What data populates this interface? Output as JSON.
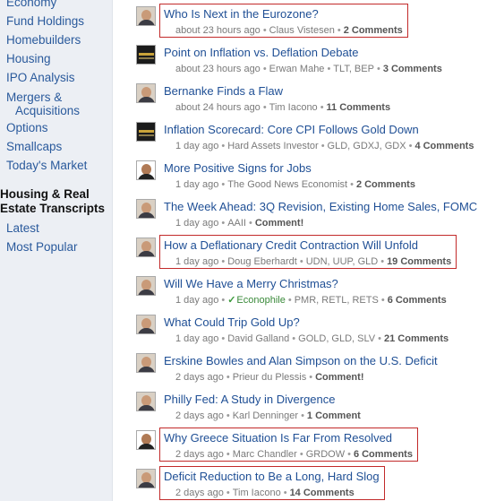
{
  "sidebar": {
    "links_top": [
      {
        "name": "sidebar-item-economy",
        "label": "Economy"
      },
      {
        "name": "sidebar-item-fund-holdings",
        "label": "Fund Holdings"
      },
      {
        "name": "sidebar-item-homebuilders",
        "label": "Homebuilders"
      },
      {
        "name": "sidebar-item-housing",
        "label": "Housing"
      },
      {
        "name": "sidebar-item-ipo-analysis",
        "label": "IPO Analysis"
      },
      {
        "name": "sidebar-item-mergers",
        "label": "Mergers &",
        "label2": "Acquisitions"
      },
      {
        "name": "sidebar-item-options",
        "label": "Options"
      },
      {
        "name": "sidebar-item-smallcaps",
        "label": "Smallcaps"
      },
      {
        "name": "sidebar-item-todays-market",
        "label": "Today's Market"
      }
    ],
    "heading_line1": "Housing & Real",
    "heading_line2": "Estate Transcripts",
    "links_bottom": [
      {
        "name": "sidebar-item-latest",
        "label": "Latest"
      },
      {
        "name": "sidebar-item-most-popular",
        "label": "Most Popular"
      }
    ]
  },
  "articles": [
    {
      "title": "Who Is Next in the Eurozone?",
      "time": "about 23 hours ago",
      "author": "Claus Vistesen",
      "tickers": "",
      "comments": "2 Comments",
      "avatar": "person",
      "highlighted": true
    },
    {
      "title": "Point on Inflation vs. Deflation Debate",
      "time": "about 23 hours ago",
      "author": "Erwan Mahe",
      "tickers": "TLT, BEP",
      "comments": "3 Comments",
      "avatar": "logo",
      "highlighted": false
    },
    {
      "title": "Bernanke Finds a Flaw",
      "time": "about 24 hours ago",
      "author": "Tim Iacono",
      "tickers": "",
      "comments": "11 Comments",
      "avatar": "person",
      "highlighted": false
    },
    {
      "title": "Inflation Scorecard: Core CPI Follows Gold Down",
      "time": "1 day ago",
      "author": "Hard Assets Investor",
      "tickers": "GLD, GDXJ, GDX",
      "comments": "4 Comments",
      "avatar": "logo",
      "highlighted": false
    },
    {
      "title": "More Positive Signs for Jobs",
      "time": "1 day ago",
      "author": "The Good News Economist",
      "tickers": "",
      "comments": "2 Comments",
      "avatar": "mono",
      "highlighted": false
    },
    {
      "title": "The Week Ahead: 3Q Revision, Existing Home Sales, FOMC",
      "time": "1 day ago",
      "author": "AAII",
      "tickers": "",
      "comments": "Comment!",
      "avatar": "person",
      "highlighted": false
    },
    {
      "title": "How a Deflationary Credit Contraction Will Unfold",
      "time": "1 day ago",
      "author": "Doug Eberhardt",
      "tickers": "UDN, UUP, GLD",
      "comments": "19 Comments",
      "avatar": "person",
      "highlighted": true
    },
    {
      "title": "Will We Have a Merry Christmas?",
      "time": "1 day ago",
      "author": "Econophile",
      "verified": true,
      "tickers": "PMR, RETL, RETS",
      "comments": "6 Comments",
      "avatar": "person",
      "highlighted": false
    },
    {
      "title": "What Could Trip Gold Up?",
      "time": "1 day ago",
      "author": "David Galland",
      "tickers": "GOLD, GLD, SLV",
      "comments": "21 Comments",
      "avatar": "person",
      "highlighted": false
    },
    {
      "title": "Erskine Bowles and Alan Simpson on the U.S. Deficit",
      "time": "2 days ago",
      "author": "Prieur du Plessis",
      "tickers": "",
      "comments": "Comment!",
      "avatar": "person",
      "highlighted": false
    },
    {
      "title": "Philly Fed: A Study in Divergence",
      "time": "2 days ago",
      "author": "Karl Denninger",
      "tickers": "",
      "comments": "1 Comment",
      "avatar": "person",
      "highlighted": false
    },
    {
      "title": "Why Greece Situation Is Far From Resolved",
      "time": "2 days ago",
      "author": "Marc Chandler",
      "tickers": "GRDOW",
      "comments": "6 Comments",
      "avatar": "mono",
      "highlighted": true
    },
    {
      "title": "Deficit Reduction to Be a Long, Hard Slog",
      "time": "2 days ago",
      "author": "Tim Iacono",
      "tickers": "",
      "comments": "14 Comments",
      "avatar": "person",
      "highlighted": true
    }
  ],
  "colors": {
    "link": "#1f4f95",
    "sidebar_bg": "#eceff4",
    "highlight_box": "#c22a2a"
  }
}
